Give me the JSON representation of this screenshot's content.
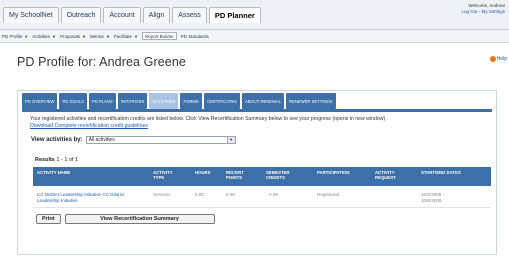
{
  "topnav": {
    "tabs": [
      "My SchoolNet",
      "Outreach",
      "Account",
      "Align",
      "Assess",
      "PD Planner"
    ],
    "active": "PD Planner"
  },
  "welcome": {
    "line1": "Welcome, Andrea!",
    "line2": "Log Out - My Settings"
  },
  "submenu": {
    "items": [
      "PD Profile",
      "Activities",
      "Proposals",
      "Mentor",
      "Facilitate"
    ],
    "report_builder": "Report Builder",
    "pd_standards": "PD Standards"
  },
  "page": {
    "title": "PD Profile for: Andrea Greene",
    "help_label": "Help"
  },
  "profile_tabs": [
    "PD OVERVIEW",
    "PD GOALS",
    "PD PLANS",
    "INITIATIVES",
    "ACTIVITIES",
    "FORMS",
    "CERTIFICATES",
    "ABOUT RENEWAL",
    "RENEWER SETTINGS"
  ],
  "active_tab": "ACTIVITIES",
  "info_text": "Your registered activities and recertification credits are listed below. Click View Recertification Summary below to see your progress (opens in new window).",
  "download_link": "Download Complete recertification credit guidelines",
  "filter": {
    "label": "View activities by:",
    "value": "All activities"
  },
  "results": {
    "label": "Results",
    "range": "1 - 1 of 1"
  },
  "table": {
    "headers": [
      "ACTIVITY NAME",
      "ACTIVITY TYPE",
      "HOURS",
      "RECERT POINTS",
      "SEMESTER CREDITS",
      "PARTICIPATION",
      "ACTIVITY REQUEST",
      "START/END DATES"
    ],
    "rows": [
      {
        "name": "CC District Leadership Initiative CC District Leadership Initiative",
        "type": "Seminar",
        "hours": "0.00",
        "recert": "0.00",
        "semester": "0.00",
        "participation": "Registered",
        "request": "",
        "dates": "10/8/2008 - 10/8/2008"
      }
    ]
  },
  "buttons": {
    "print": "Print",
    "summary": "View Recertification Summary"
  },
  "colors": {
    "tab_blue": "#3d6fa8",
    "tab_active": "#a8c3e3",
    "link": "#1f5bb5"
  }
}
